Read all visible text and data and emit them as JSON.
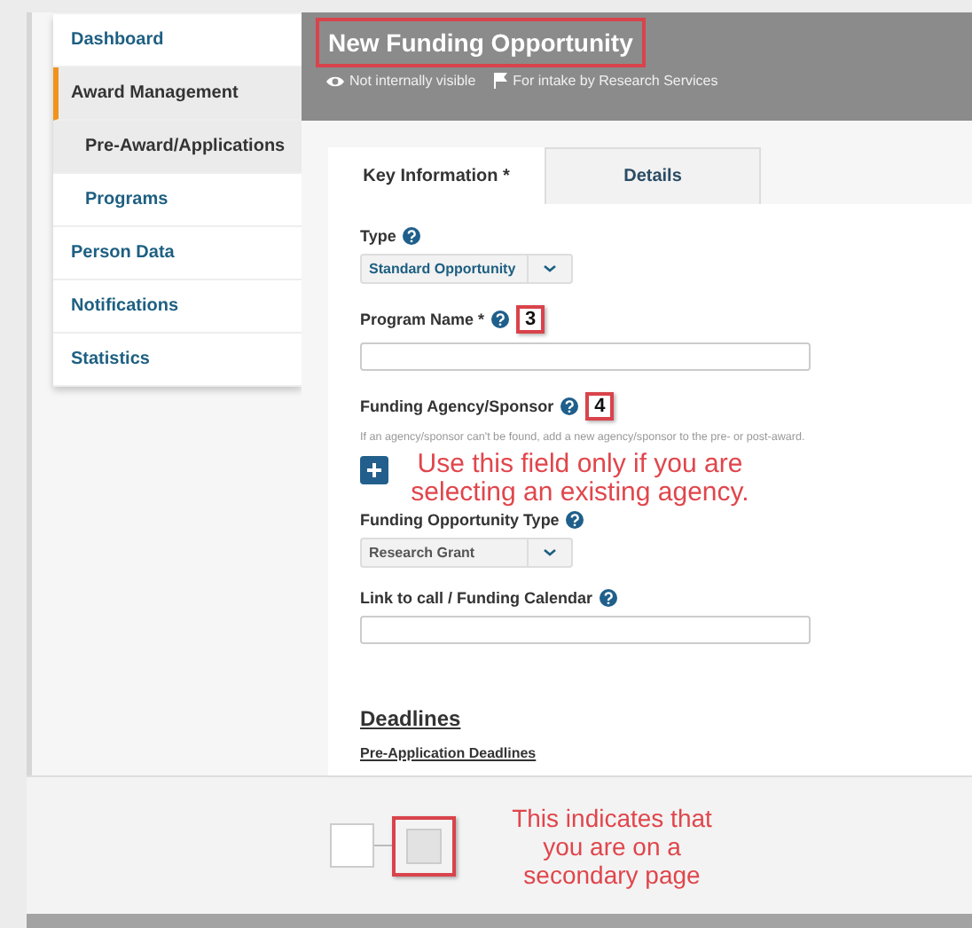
{
  "sidebar": {
    "items": [
      {
        "label": "Dashboard",
        "selected": false
      },
      {
        "label": "Award Management",
        "selected": true,
        "children": [
          {
            "label": "Pre-Award/Applications",
            "selected": true
          },
          {
            "label": "Programs",
            "selected": false
          }
        ]
      },
      {
        "label": "Person Data",
        "selected": false
      },
      {
        "label": "Notifications",
        "selected": false
      },
      {
        "label": "Statistics",
        "selected": false
      }
    ]
  },
  "header": {
    "title": "New Funding Opportunity",
    "title_highlighted": true,
    "badges": [
      {
        "kind": "eye",
        "text": "Not internally visible"
      },
      {
        "kind": "flag",
        "text": "For intake by Research Services"
      }
    ]
  },
  "tabs": [
    {
      "label": "Key Information *",
      "selected": true
    },
    {
      "label": "Details",
      "selected": false
    }
  ],
  "fields": [
    {
      "kind": "select",
      "label": "Type",
      "value": "Standard Opportunity"
    },
    {
      "kind": "text",
      "label": "Program Name *",
      "callout": "3"
    },
    {
      "kind": "lookup",
      "label": "Funding Agency/Sponsor",
      "callout": "4",
      "hint": "If an agency/sponsor can't be found, add a new agency/sponsor to the pre- or post-award.",
      "note": "Use this field only if you are selecting an existing agency."
    },
    {
      "kind": "select",
      "label": "Funding Opportunity Type",
      "value": "Research Grant"
    },
    {
      "kind": "text",
      "label": "Link to call / Funding Calendar"
    }
  ],
  "deadlines": {
    "heading": "Deadlines",
    "subheading": "Pre-Application Deadlines"
  },
  "footer": {
    "pages": [
      {
        "selected": false
      },
      {
        "selected": true
      }
    ],
    "note": "This indicates that you are on a secondary page"
  }
}
